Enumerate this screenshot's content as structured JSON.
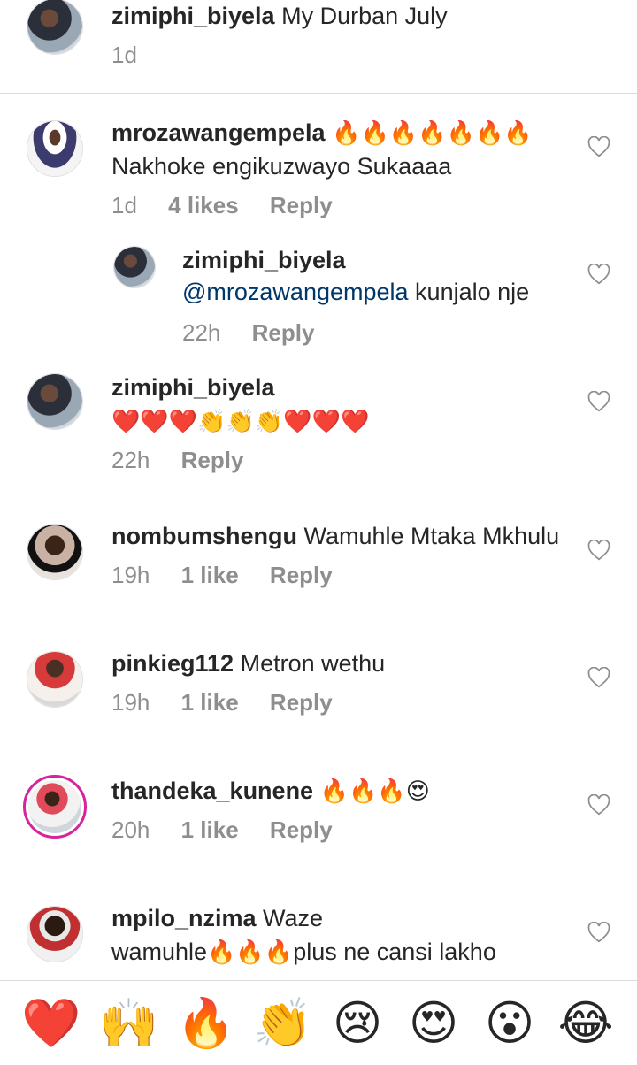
{
  "caption": {
    "username": "zimiphi_biyela",
    "text": "My Durban July",
    "time": "1d"
  },
  "comments": [
    {
      "username": "mrozawangempela",
      "emoji_suffix": "🔥🔥🔥🔥🔥🔥🔥",
      "text": "Nakhoke engikuzwayo Sukaaaa",
      "time": "1d",
      "likes": "4 likes",
      "reply": "Reply"
    },
    {
      "username": "zimiphi_biyela",
      "mention": "@mrozawangempela",
      "text": "kunjalo nje",
      "time": "22h",
      "reply": "Reply"
    },
    {
      "username": "zimiphi_biyela",
      "text": "❤️❤️❤️👏👏👏❤️❤️❤️",
      "time": "22h",
      "reply": "Reply"
    },
    {
      "username": "nombumshengu",
      "text": "Wamuhle Mtaka Mkhulu",
      "time": "19h",
      "likes": "1 like",
      "reply": "Reply"
    },
    {
      "username": "pinkieg112",
      "text": "Metron wethu",
      "time": "19h",
      "likes": "1 like",
      "reply": "Reply"
    },
    {
      "username": "thandeka_kunene",
      "emoji_suffix": "🔥🔥🔥😍",
      "time": "20h",
      "likes": "1 like",
      "reply": "Reply"
    },
    {
      "username": "mpilo_nzima",
      "text": "Waze",
      "line2_a": "wamuhle",
      "line2_emoji": "🔥🔥🔥",
      "line2_b": "plus ne cansi lakho"
    }
  ],
  "reactions": [
    "❤️",
    "🙌",
    "🔥",
    "👏",
    "😢",
    "😍",
    "😮",
    "😂"
  ]
}
